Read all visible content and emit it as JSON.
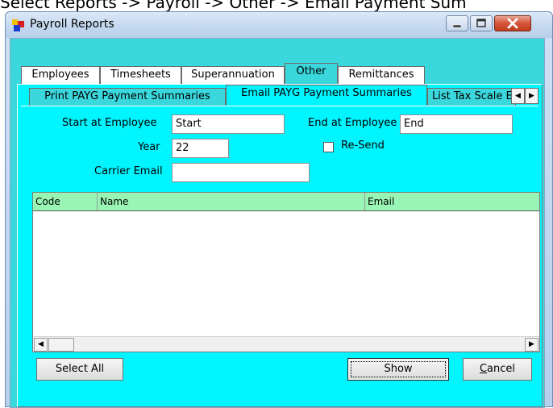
{
  "caption": "Select Reports -> Payroll -> Other -> Email Payment Sum",
  "window": {
    "title": "Payroll Reports",
    "controls": {
      "minimize": "minimize-icon",
      "maximize": "maximize-icon",
      "close": "close-icon"
    }
  },
  "top_tabs": [
    "Employees",
    "Timesheets",
    "Superannuation",
    "Other",
    "Remittances"
  ],
  "top_tabs_selected": "Other",
  "sub_tabs": [
    "Print PAYG Payment Summaries",
    "Email PAYG Payment Summaries",
    "List Tax Scale E"
  ],
  "sub_tabs_selected": "Email PAYG Payment Summaries",
  "form": {
    "start_label": "Start at Employee",
    "start_value": "Start",
    "end_label": "End at Employee",
    "end_value": "End",
    "year_label": "Year",
    "year_value": "22",
    "resend_label": "Re-Send",
    "resend_checked": false,
    "carrier_label": "Carrier Email",
    "carrier_value": ""
  },
  "list": {
    "columns": [
      "Code",
      "Name",
      "Email"
    ],
    "rows": []
  },
  "buttons": {
    "select_all": "Select All",
    "show": "Show",
    "cancel_prefix": "C",
    "cancel_rest": "ancel"
  },
  "colors": {
    "panel": "#00f5ff",
    "header": "#98f5b4"
  }
}
